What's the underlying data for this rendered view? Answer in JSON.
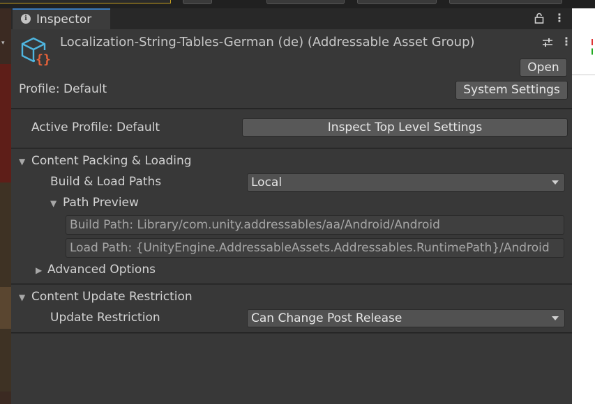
{
  "inspector": {
    "tab_label": "Inspector",
    "asset_title": "Localization-String-Tables-German (de) (Addressable Asset Group)",
    "open_label": "Open",
    "profile_label": "Profile: Default",
    "system_settings_label": "System Settings",
    "active_profile_label": "Active Profile: Default",
    "inspect_top_level_label": "Inspect Top Level Settings",
    "content_packing": {
      "header": "Content Packing & Loading",
      "build_load_paths_label": "Build & Load Paths",
      "build_load_paths_value": "Local",
      "path_preview_label": "Path Preview",
      "build_path": "Build Path: Library/com.unity.addressables/aa/Android/Android",
      "load_path": "Load Path: {UnityEngine.AddressableAssets.Addressables.RuntimePath}/Android",
      "advanced_options_label": "Advanced Options"
    },
    "content_update": {
      "header": "Content Update Restriction",
      "update_restriction_label": "Update Restriction",
      "update_restriction_value": "Can Change Post Release"
    }
  },
  "icons": [
    "info-icon",
    "lock-icon",
    "kebab-menu-icon",
    "addressable-group-icon",
    "preset-sliders-icon",
    "dropdown-arrow-icon",
    "foldout-arrow-icon"
  ],
  "colors": {
    "panel_bg": "#383838",
    "tab_accent": "#3a79bb",
    "icon_cube": "#4fb6e0",
    "icon_braces": "#e8623a"
  }
}
